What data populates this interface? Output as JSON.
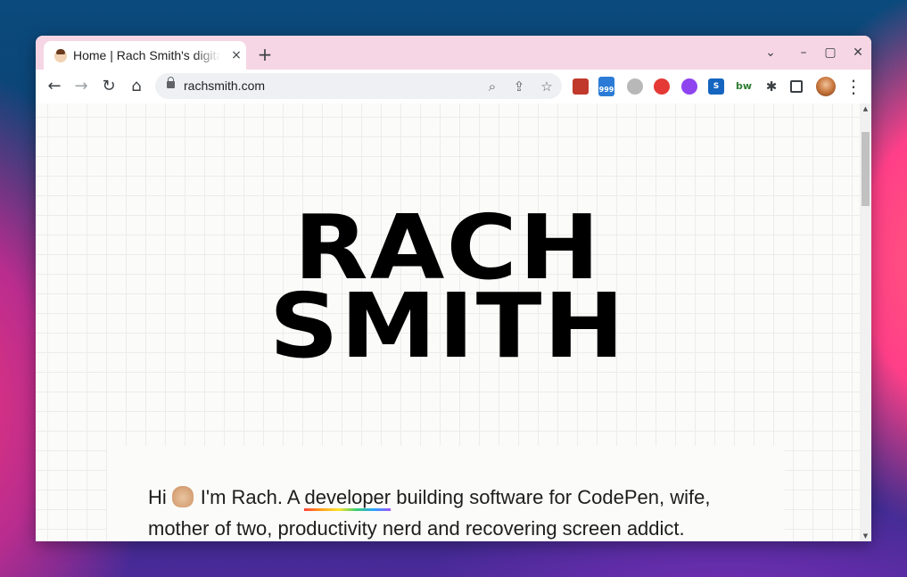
{
  "browser": {
    "tab": {
      "title": "Home | Rach Smith's digital garden",
      "close_glyph": "×",
      "favicon": "rach-avatar-icon"
    },
    "new_tab_glyph": "+",
    "window_controls": {
      "tab_search": "⌄",
      "minimize": "–",
      "maximize": "▢",
      "close": "✕"
    },
    "toolbar": {
      "back": "←",
      "forward": "→",
      "reload": "↻",
      "home": "⌂",
      "url": "rachsmith.com",
      "zoom_icon": "⌕",
      "share_icon": "⇪",
      "bookmark_icon": "☆",
      "menu": "⋮"
    },
    "extensions": [
      {
        "name": "book-extension-icon",
        "label": "",
        "color": "#c0392b"
      },
      {
        "name": "counter-extension-icon",
        "label": "999",
        "color": "#2b7bd6"
      },
      {
        "name": "circle-extension-icon",
        "label": "",
        "color": "#b8b8b8"
      },
      {
        "name": "red-extension-icon",
        "label": "",
        "color": "#e53935"
      },
      {
        "name": "purple-extension-icon",
        "label": "",
        "color": "#8e44ef"
      },
      {
        "name": "s-extension-icon",
        "label": "S",
        "color": "#1565c0"
      },
      {
        "name": "bw-extension-icon",
        "label": "bw",
        "color": "#2e7d32"
      }
    ]
  },
  "page": {
    "hero_line1": "RACH",
    "hero_line2": "SMITH",
    "intro": {
      "hi": "Hi",
      "before_link": "I'm Rach. A ",
      "link": "developer",
      "after_link": " building software for CodePen, wife, mother of two, productivity nerd and recovering screen addict."
    }
  }
}
